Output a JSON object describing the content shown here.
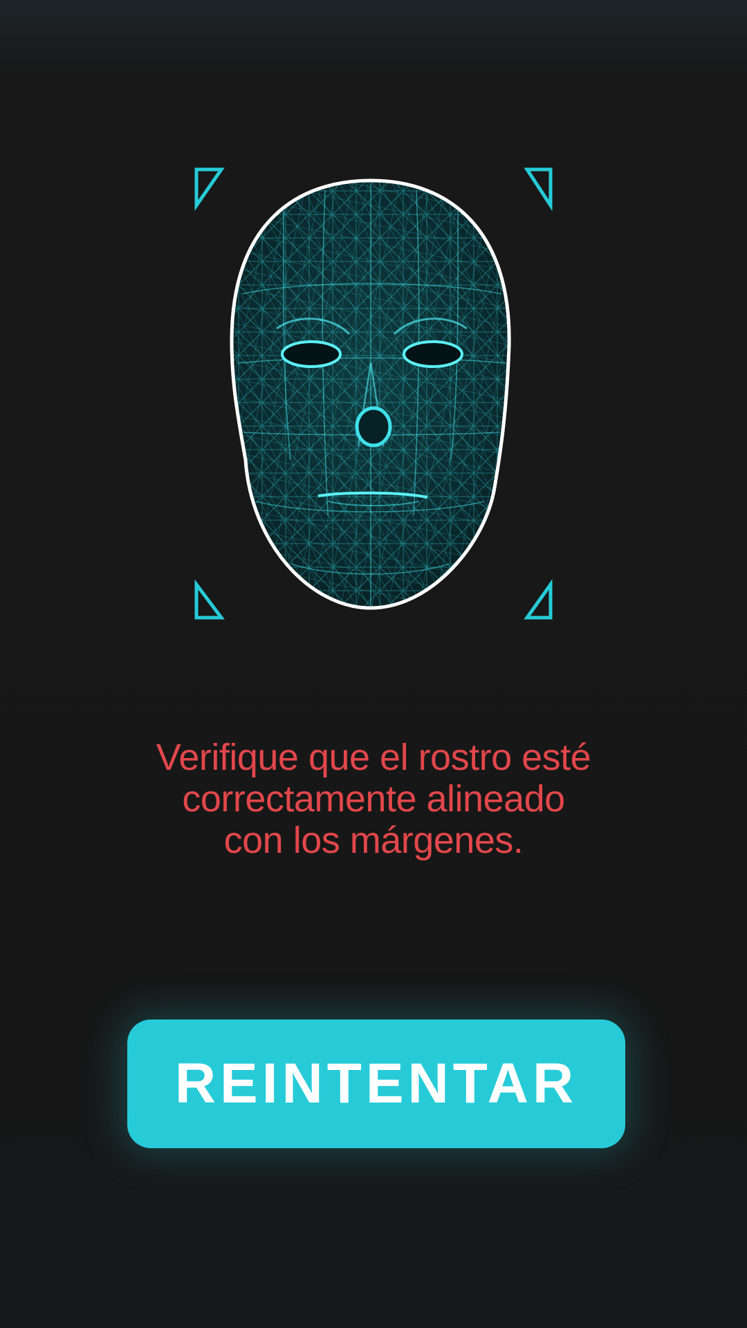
{
  "scanner": {
    "frame_color": "#27cbd8",
    "mesh_color": "#2ec4cc",
    "outline_color": "#ffffff",
    "icon": "face-mesh-icon"
  },
  "message": {
    "lines": [
      "Verifique que el rostro esté",
      "correctamente alineado",
      "con los márgenes."
    ],
    "color": "#e2474b"
  },
  "retry_button": {
    "label": "REINTENTAR",
    "color": "#27cbd8"
  }
}
